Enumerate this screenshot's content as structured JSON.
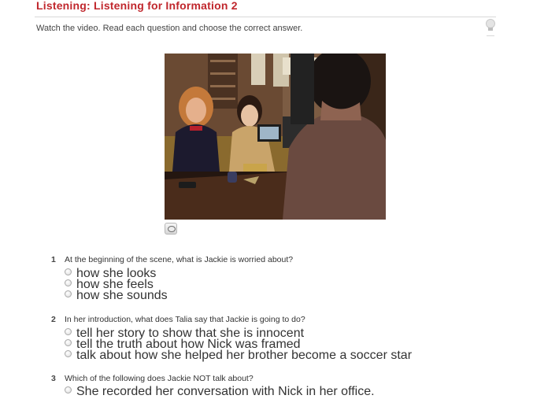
{
  "header": {
    "title": "Listening: Listening for Information 2",
    "instructions": "Watch the video. Read each question and choose the correct answer."
  },
  "questions": [
    {
      "number": "1",
      "text": "At the beginning of the scene, what is Jackie is worried about?",
      "options": [
        "how she looks",
        "how she feels",
        "how she sounds"
      ]
    },
    {
      "number": "2",
      "text": "In her introduction, what does Talia say that Jackie is going to do?",
      "options": [
        "tell her story to show that she is innocent",
        "tell the truth about how Nick was framed",
        "talk about how she helped her brother become a soccer star"
      ]
    },
    {
      "number": "3",
      "text": "Which of the following does Jackie NOT talk about?",
      "options": [
        "She recorded her conversation with Nick in her office."
      ]
    }
  ],
  "colors": {
    "title": "#c0272d",
    "text": "#333333",
    "rule": "#d9d9d9"
  },
  "icons": {
    "hint": "lightbulb-icon",
    "caption": "speech-bubble-icon",
    "radio": "radio-button"
  }
}
